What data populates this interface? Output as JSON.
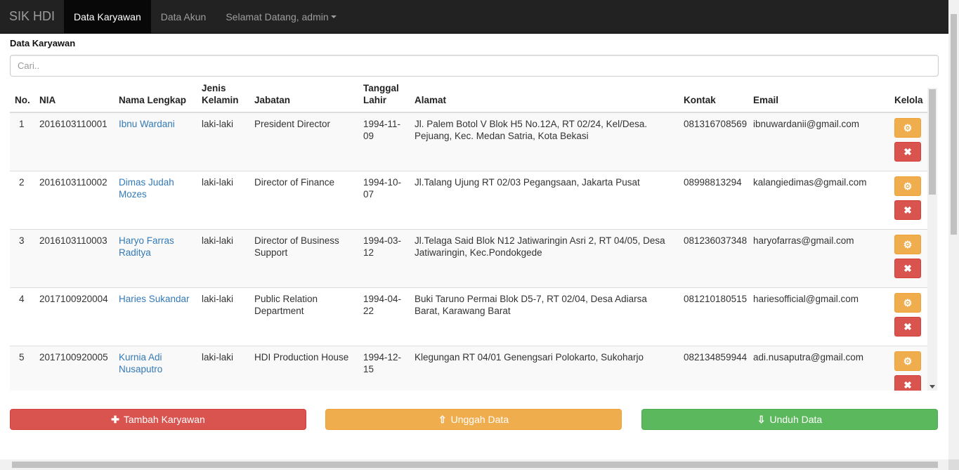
{
  "navbar": {
    "brand": "SIK HDI",
    "items": [
      {
        "label": "Data Karyawan",
        "active": true
      },
      {
        "label": "Data Akun",
        "active": false
      },
      {
        "label": "Selamat Datang, admin",
        "active": false,
        "dropdown": true
      }
    ]
  },
  "page": {
    "title": "Data Karyawan",
    "search_placeholder": "Cari.."
  },
  "table": {
    "headers": [
      "No.",
      "NIA",
      "Nama Lengkap",
      "Jenis Kelamin",
      "Jabatan",
      "Tanggal Lahir",
      "Alamat",
      "Kontak",
      "Email",
      "Kelola"
    ],
    "rows": [
      {
        "no": "1",
        "nia": "2016103110001",
        "nama": "Ibnu Wardani",
        "jk": "laki-laki",
        "jabatan": "President Director",
        "tgl": "1994-11-09",
        "alamat": "Jl. Palem Botol V Blok H5 No.12A, RT 02/24, Kel/Desa. Pejuang, Kec. Medan Satria, Kota Bekasi",
        "kontak": "081316708569",
        "email": "ibnuwardanii@gmail.com"
      },
      {
        "no": "2",
        "nia": "2016103110002",
        "nama": "Dimas Judah Mozes",
        "jk": "laki-laki",
        "jabatan": "Director of Finance",
        "tgl": "1994-10-07",
        "alamat": "Jl.Talang Ujung RT 02/03 Pegangsaan, Jakarta Pusat",
        "kontak": "08998813294",
        "email": "kalangiedimas@gmail.com"
      },
      {
        "no": "3",
        "nia": "2016103110003",
        "nama": "Haryo Farras Raditya",
        "jk": "laki-laki",
        "jabatan": "Director of Business Support",
        "tgl": "1994-03-12",
        "alamat": "Jl.Telaga Said Blok N12 Jatiwaringin Asri 2, RT 04/05, Desa Jatiwaringin, Kec.Pondokgede",
        "kontak": "081236037348",
        "email": "haryofarras@gmail.com"
      },
      {
        "no": "4",
        "nia": "2017100920004",
        "nama": "Haries Sukandar",
        "jk": "laki-laki",
        "jabatan": "Public Relation Department",
        "tgl": "1994-04-22",
        "alamat": "Buki Taruno Permai Blok D5-7, RT 02/04, Desa Adiarsa Barat, Karawang Barat",
        "kontak": "081210180515",
        "email": "hariesofficial@gmail.com"
      },
      {
        "no": "5",
        "nia": "2017100920005",
        "nama": "Kurnia Adi Nusaputro",
        "jk": "laki-laki",
        "jabatan": "HDI Production House",
        "tgl": "1994-12-15",
        "alamat": "Klegungan RT 04/01 Genengsari Polokarto, Sukoharjo",
        "kontak": "082134859944",
        "email": "adi.nusaputra@gmail.com"
      }
    ]
  },
  "actions": {
    "add_label": "Tambah Karyawan",
    "upload_label": "Unggah Data",
    "download_label": "Unduh Data"
  },
  "icons": {
    "edit": "gear-icon",
    "delete": "close-icon",
    "add": "plus-icon",
    "upload": "upload-circle-icon",
    "download": "download-circle-icon"
  },
  "colors": {
    "navbar": "#222222",
    "link": "#337ab7",
    "danger": "#d9534f",
    "warning": "#f0ad4e",
    "success": "#5cb85c"
  }
}
